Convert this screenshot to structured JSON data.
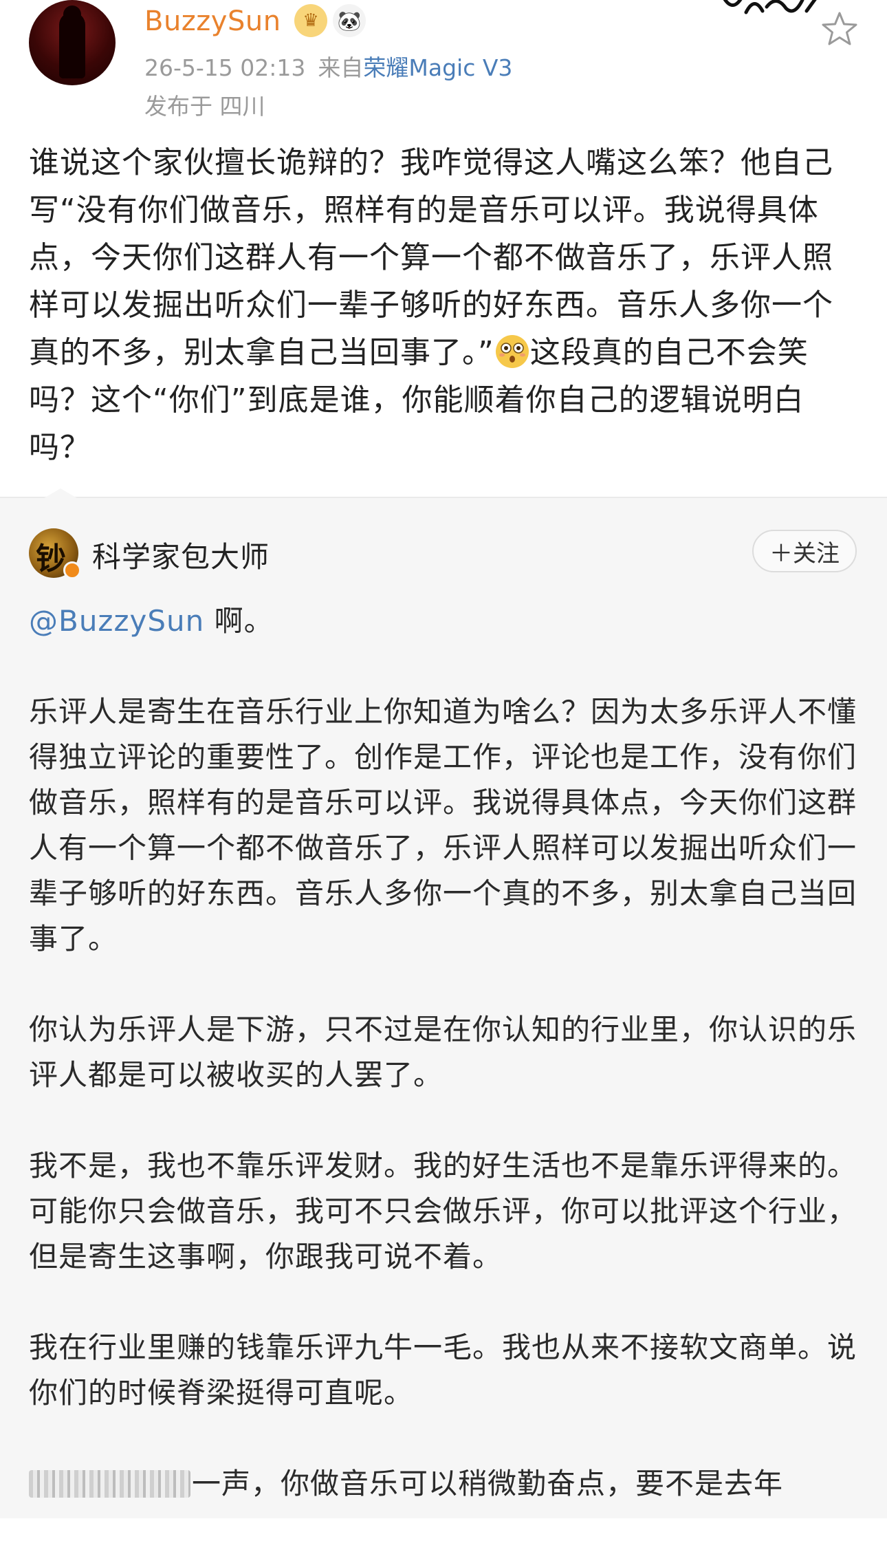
{
  "post": {
    "author": {
      "name": "BuzzySun",
      "badges": [
        "crown-badge-icon",
        "panda-badge-icon"
      ],
      "name_color": "#e9822d"
    },
    "timestamp": "26-5-15 02:13",
    "source_prefix": "来自",
    "device": "荣耀Magic V3",
    "location": "发布于 四川",
    "text_before_emoji": "谁说这个家伙擅长诡辩的？我咋觉得这人嘴这么笨？他自己写“没有你们做音乐，照样有的是音乐可以评。我说得具体点，今天你们这群人有一个算一个都不做音乐了，乐评人照样可以发掘出听众们一辈子够听的好东西。音乐人多你一个真的不多，别太拿自己当回事了。”",
    "emoji": "flushed-face-icon",
    "text_after_emoji": "这段真的自己不会笑吗？这个“你们”到底是谁，你能顺着你自己的逻辑说明白吗？"
  },
  "reposted": {
    "author": {
      "name": "科学家包大师",
      "verified_color": "#f08a1a"
    },
    "follow_label": "＋关注",
    "mention": "@BuzzySun",
    "mention_suffix": " 啊。",
    "paragraphs": [
      "乐评人是寄生在音乐行业上你知道为啥么？因为太多乐评人不懂得独立评论的重要性了。创作是工作，评论也是工作，没有你们做音乐，照样有的是音乐可以评。我说得具体点，今天你们这群人有一个算一个都不做音乐了，乐评人照样可以发掘出听众们一辈子够听的好东西。音乐人多你一个真的不多，别太拿自己当回事了。",
      "你认为乐评人是下游，只不过是在你认知的行业里，你认识的乐评人都是可以被收买的人罢了。",
      "我不是，我也不靠乐评发财。我的好生活也不是靠乐评得来的。可能你只会做音乐，我可不只会做乐评，你可以批评这个行业，但是寄生这事啊，你跟我可说不着。",
      "我在行业里赚的钱靠乐评九牛一毛。我也从来不接软文商单。说你们的时候脊梁挺得可直呢。"
    ],
    "last_line_visible": "一声，你做音乐可以稍微勤奋点，要不是去年"
  },
  "colors": {
    "link": "#4a7db8",
    "meta": "#9a9a9a",
    "repost_bg": "#f6f6f6"
  }
}
